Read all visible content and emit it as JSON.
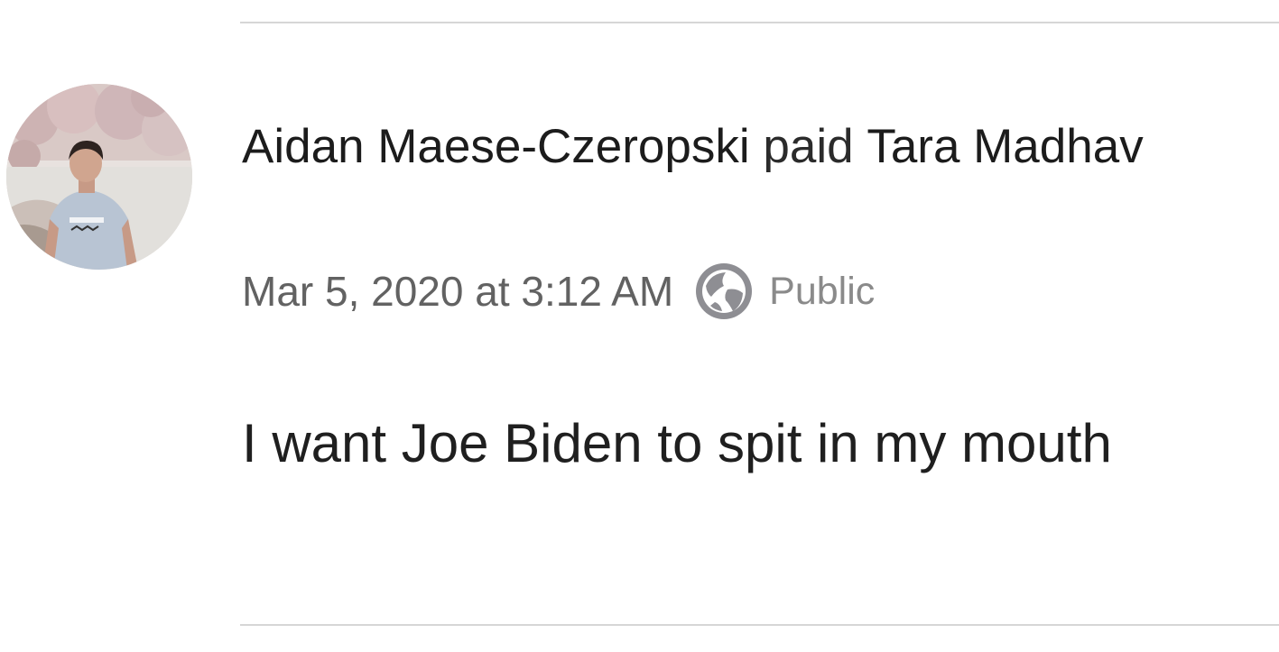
{
  "story": {
    "actor": "Aidan Maese-Czeropski",
    "verb": "paid",
    "recipient": "Tara Madhav",
    "timestamp": "Mar 5, 2020 at 3:12 AM",
    "privacy_icon": "globe-icon",
    "privacy_label": "Public",
    "note": "I want Joe Biden to spit in my mouth"
  },
  "colors": {
    "text_primary": "#1f1f1f",
    "text_secondary": "#626262",
    "icon_gray": "#8e8e93",
    "divider": "#d6d6d6",
    "background": "#ffffff"
  }
}
